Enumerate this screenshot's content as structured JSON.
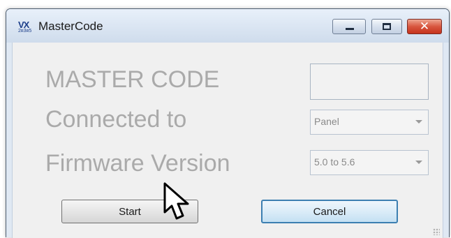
{
  "window": {
    "title": "MasterCode",
    "icon_text": "VX",
    "icon_subtext": "2ʀ3ʀ5"
  },
  "form": {
    "master_code_label": "MASTER CODE",
    "master_code_value": "",
    "connected_label": "Connected to",
    "connected_value": "Panel",
    "firmware_label": "Firmware Version",
    "firmware_value": "5.0 to 5.6"
  },
  "buttons": {
    "start": "Start",
    "cancel": "Cancel"
  },
  "icons": {
    "app": "vx-logo-icon",
    "minimize": "minimize-icon",
    "maximize": "maximize-icon",
    "close": "close-icon",
    "dropdown": "chevron-down-icon",
    "cursor": "mouse-pointer-icon",
    "grip": "resize-grip-icon"
  },
  "colors": {
    "close_button": "#d8563f",
    "default_button_border": "#3c7fb1",
    "disabled_text": "#aaaaaa"
  }
}
